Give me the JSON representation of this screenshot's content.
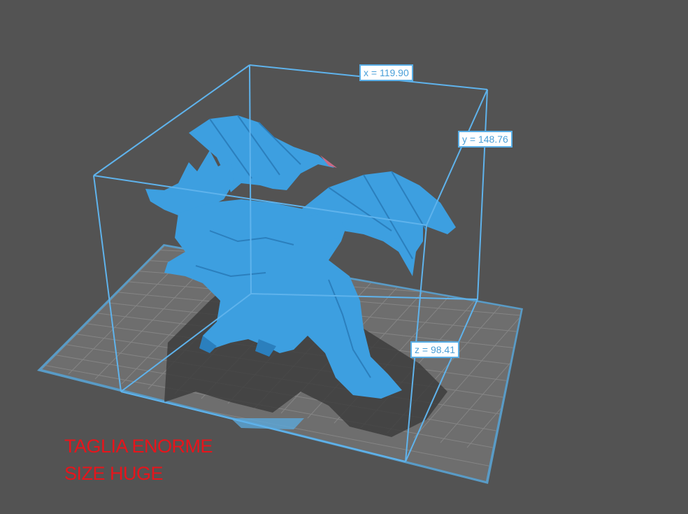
{
  "dimensions": {
    "x": "x = 119.90",
    "y": "y = 148.76",
    "z": "z = 98.41"
  },
  "overlay": {
    "line1": "TAGLIA ENORME",
    "line2": "SIZE HUGE"
  },
  "colors": {
    "background": "#535353",
    "model": "#3d9fe0",
    "bounding_box": "#5fb3ec",
    "build_plate": "#6e6e6e",
    "overlay_text": "#e8141b"
  },
  "icons": [
    "dragon-model",
    "build-plate",
    "bounding-box"
  ]
}
